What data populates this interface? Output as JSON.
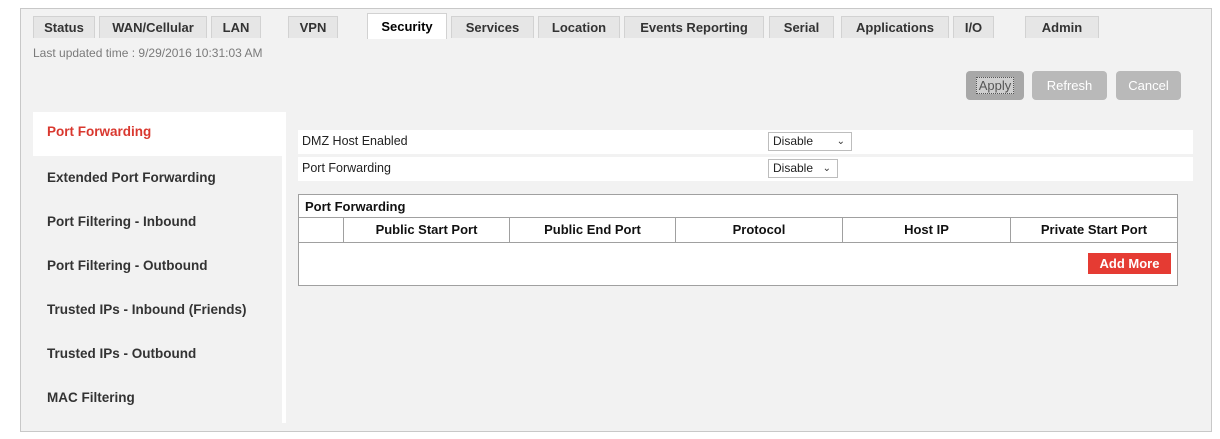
{
  "tabs": [
    {
      "label": "Status"
    },
    {
      "label": "WAN/Cellular"
    },
    {
      "label": "LAN"
    },
    {
      "label": "VPN"
    },
    {
      "label": "Security",
      "active": true
    },
    {
      "label": "Services"
    },
    {
      "label": "Location"
    },
    {
      "label": "Events Reporting"
    },
    {
      "label": "Serial"
    },
    {
      "label": "Applications"
    },
    {
      "label": "I/O"
    },
    {
      "label": "Admin"
    }
  ],
  "header": {
    "last_updated": "Last updated time : 9/29/2016 10:31:03 AM",
    "apply_label": "Apply",
    "refresh_label": "Refresh",
    "cancel_label": "Cancel"
  },
  "sidebar": {
    "items": [
      {
        "label": "Port Forwarding",
        "active": true
      },
      {
        "label": "Extended Port Forwarding"
      },
      {
        "label": "Port Filtering - Inbound"
      },
      {
        "label": "Port Filtering - Outbound"
      },
      {
        "label": "Trusted IPs - Inbound (Friends)"
      },
      {
        "label": "Trusted IPs - Outbound"
      },
      {
        "label": "MAC Filtering"
      }
    ]
  },
  "settings": {
    "dmz": {
      "label": "DMZ Host Enabled",
      "value": "Disable"
    },
    "port_forwarding": {
      "label": "Port Forwarding",
      "value": "Disable"
    }
  },
  "table": {
    "title": "Port Forwarding",
    "columns": [
      "",
      "Public Start Port",
      "Public End Port",
      "Protocol",
      "Host IP",
      "Private Start Port"
    ],
    "add_more_label": "Add More"
  },
  "colors": {
    "accent": "#d9382f",
    "add_button": "#e53b33",
    "button_gray": "#b9b9b9",
    "panel_bg": "#f2f2f2"
  },
  "icons": {
    "select_chevron": "chevron-down-icon"
  }
}
